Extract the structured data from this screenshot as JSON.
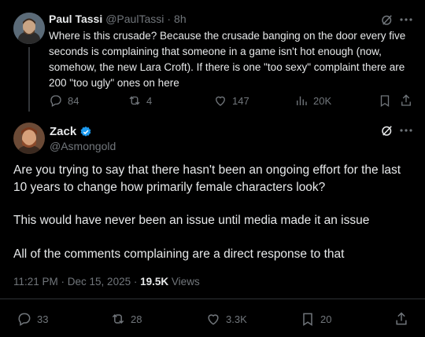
{
  "reply_tweet": {
    "author_name": "Paul Tassi",
    "author_handle": "@PaulTassi",
    "separator": "·",
    "time": "8h",
    "text": "Where is this crusade? Because the crusade banging on the door every five seconds is complaining that someone in a game isn't hot enough (now, somehow, the new Lara Croft). If there is one \"too sexy\" complaint there are 200 \"too ugly\" ones on here",
    "replies": "84",
    "reposts": "4",
    "likes": "147",
    "views": "20K"
  },
  "main_tweet": {
    "author_name": "Zack",
    "author_handle": "@Asmongold",
    "paragraphs": [
      "Are you trying to say that there hasn't been an ongoing effort for the last 10 years to change how primarily female characters look?",
      "This would have never been an issue until media made it an issue",
      "All of the comments complaining are a direct response to that"
    ],
    "timestamp": "11:21 PM · Dec 15, 2025",
    "separator": "·",
    "views_count": "19.5K",
    "views_label": "Views",
    "replies": "33",
    "reposts": "28",
    "likes": "3.3K",
    "bookmarks": "20"
  },
  "colors": {
    "background": "#000000",
    "text": "#e7e9ea",
    "secondary": "#71767b",
    "verified": "#1d9bf0"
  }
}
